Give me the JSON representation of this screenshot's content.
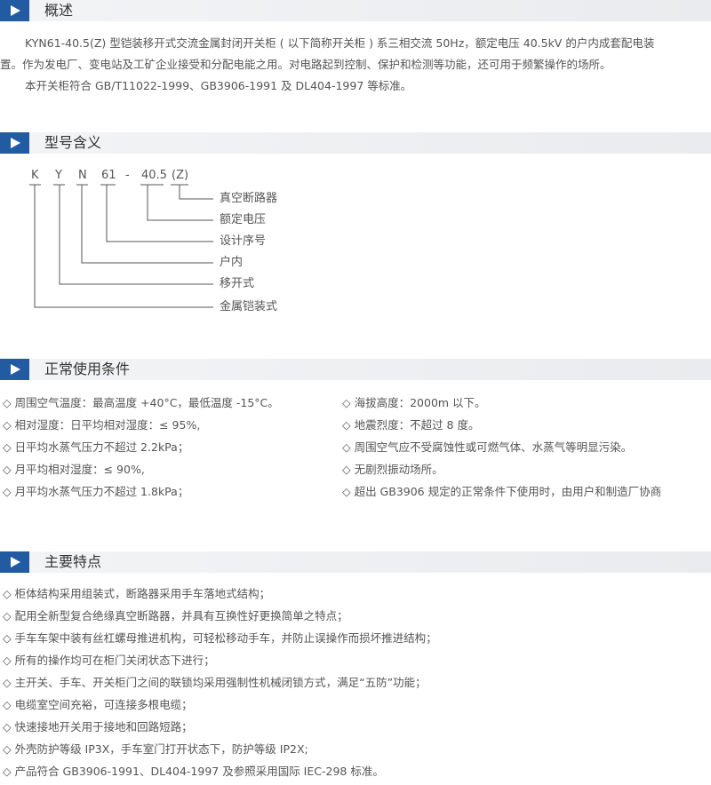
{
  "sections": {
    "overview": "概述",
    "model": "型号含义",
    "conditions": "正常使用条件",
    "features": "主要特点"
  },
  "overview": {
    "p1_line1": "KYN61-40.5(Z) 型铠装移开式交流金属封闭开关柜 ( 以下简称开关柜 ) 系三相交流 50Hz，额定电压 40.5kV 的户内成套配电装",
    "p1_line2": "置。作为发电厂、变电站及工矿企业接受和分配电能之用。对电路起到控制、保护和检测等功能，还可用于频繁操作的场所。",
    "p2": "本开关柜符合 GB/T11022-1999、GB3906-1991 及 DL404-1997 等标准。"
  },
  "model": {
    "code": [
      "K",
      "Y",
      "N",
      "61",
      "-",
      "40.5",
      "(Z)"
    ],
    "labels": [
      "真空断路器",
      "额定电压",
      "设计序号",
      "户内",
      "移开式",
      "金属铠装式"
    ]
  },
  "conditions": {
    "left": [
      "◇ 周围空气温度：最高温度 +40°C，最低温度 -15°C。",
      "◇ 相对湿度：日平均相对湿度：≤ 95%,",
      "◇ 日平均水蒸气压力不超过 2.2kPa；",
      "◇ 月平均相对湿度：≤ 90%,",
      "◇ 月平均水蒸气压力不超过 1.8kPa；"
    ],
    "right": [
      "◇ 海拔高度：2000m 以下。",
      "◇ 地震烈度：不超过 8 度。",
      "◇ 周围空气应不受腐蚀性或可燃气体、水蒸气等明显污染。",
      "◇ 无剧烈振动场所。",
      "◇ 超出 GB3906 规定的正常条件下使用时，由用户和制造厂协商"
    ]
  },
  "features": [
    "◇ 柜体结构采用组装式，断路器采用手车落地式结构；",
    "◇ 配用全新型复合绝缘真空断路器，并具有互换性好更换简单之特点；",
    "◇ 手车车架中装有丝杠螺母推进机构，可轻松移动手车，并防止误操作而损坏推进结构；",
    "◇ 所有的操作均可在柜门关闭状态下进行；",
    "◇ 主开关、手车、开关柜门之间的联锁均采用强制性机械闭锁方式，满足“五防”功能；",
    "◇ 电缆室空间充裕，可连接多根电缆；",
    "◇ 快速接地开关用于接地和回路短路；",
    "◇ 外壳防护等级 IP3X，手车室门打开状态下，防护等级 IP2X;",
    "◇ 产品符合 GB3906-1991、DL404-1997 及参照采用国际 IEC-298 标准。"
  ]
}
